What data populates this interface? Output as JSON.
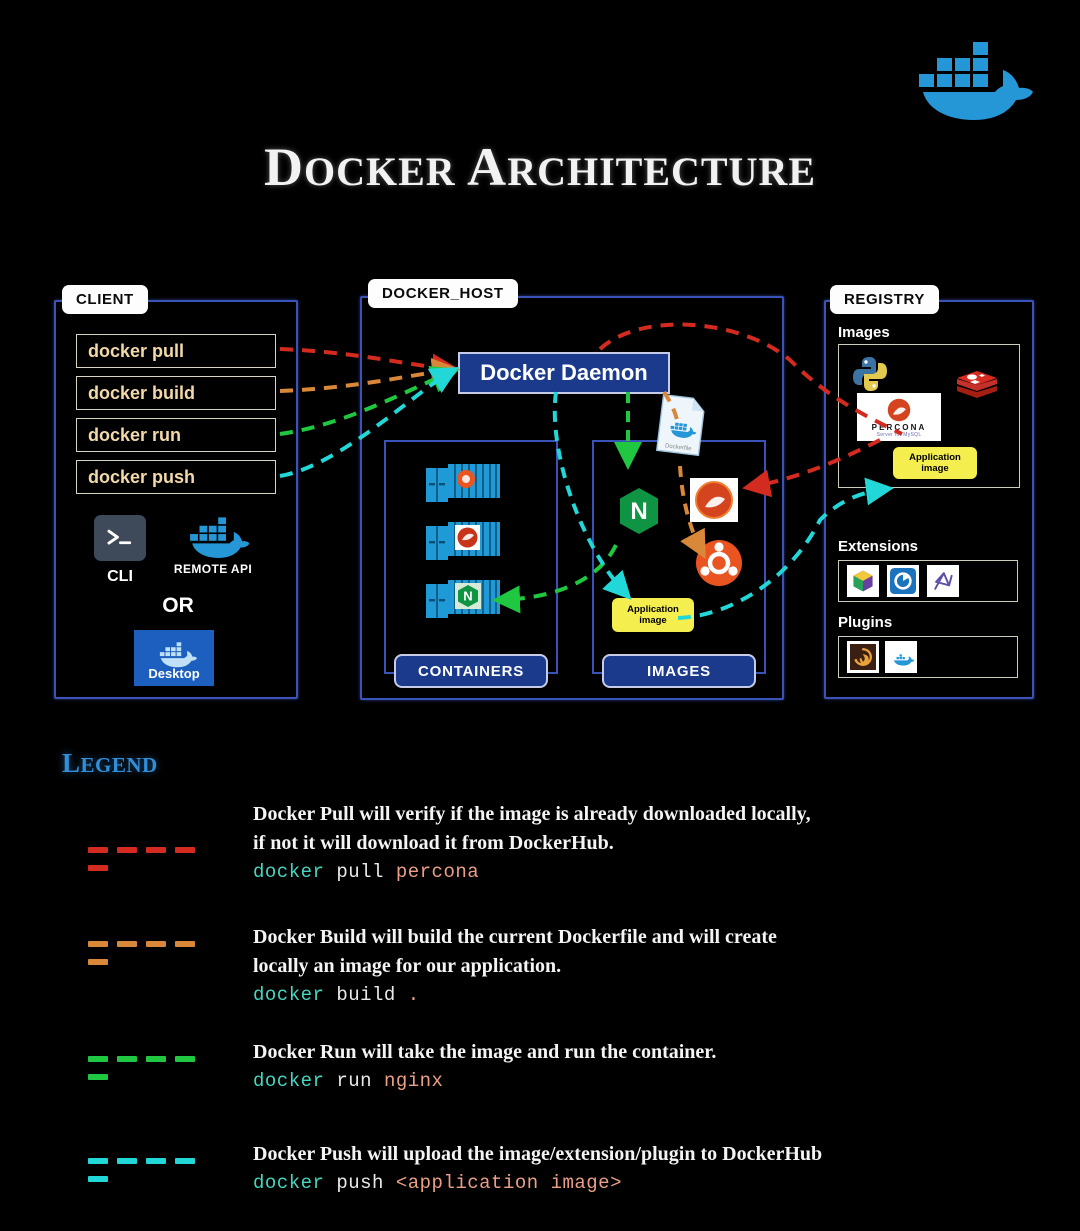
{
  "header": {
    "title_parts": [
      {
        "text": "D",
        "style": "cap"
      },
      {
        "text": "OCKER",
        "style": "sc"
      },
      {
        "text": " A",
        "style": "cap"
      },
      {
        "text": "RCHITECTURE",
        "style": "sc"
      }
    ],
    "title": "DOCKER ARCHITECTURE",
    "logo_icon": "docker-whale-icon",
    "accent_color": "#2596d6"
  },
  "client": {
    "tab_label": "CLIENT",
    "commands": [
      {
        "label": "docker pull",
        "line_color": "#d42b20"
      },
      {
        "label": "docker build",
        "line_color": "#d9883a"
      },
      {
        "label": "docker run",
        "line_color": "#1fc840"
      },
      {
        "label": "docker push",
        "line_color": "#22d7d7"
      }
    ],
    "cli": {
      "icon": "terminal-prompt-icon",
      "glyph": ">_",
      "label": "CLI"
    },
    "remote_api": {
      "icon": "docker-whale-icon",
      "label": "REMOTE API"
    },
    "or_label": "OR",
    "desktop": {
      "icon": "docker-whale-icon",
      "label": "Desktop",
      "color": "#1d5fbf"
    }
  },
  "docker_host": {
    "tab_label": "DOCKER_HOST",
    "daemon_label": "Docker Daemon",
    "containers": {
      "section_label": "CONTAINERS",
      "items": [
        {
          "icon": "ubuntu-container-icon",
          "name": "ubuntu"
        },
        {
          "icon": "percona-container-icon",
          "name": "percona"
        },
        {
          "icon": "nginx-container-icon",
          "name": "nginx"
        }
      ]
    },
    "images": {
      "section_label": "IMAGES",
      "items": [
        {
          "icon": "nginx-icon",
          "name": "nginx"
        },
        {
          "icon": "percona-icon",
          "name": "percona"
        },
        {
          "icon": "ubuntu-icon",
          "name": "ubuntu"
        }
      ],
      "application_image_label": "Application image",
      "application_image_line1": "Application",
      "application_image_line2": "image",
      "application_image_color": "#f4ee4f"
    },
    "dockerfile": {
      "icon": "dockerfile-icon",
      "label": "Dockerfile"
    }
  },
  "registry": {
    "tab_label": "REGISTRY",
    "images_label": "Images",
    "images_items": [
      {
        "icon": "python-icon",
        "name": "python"
      },
      {
        "icon": "redis-icon",
        "name": "redis"
      },
      {
        "icon": "percona-icon",
        "name": "percona"
      }
    ],
    "percona_word": "PERCONA",
    "percona_sub": "Server for MySQL",
    "application_image_line1": "Application",
    "application_image_line2": "image",
    "extensions_label": "Extensions",
    "extensions_items": [
      {
        "icon": "cube-extension-icon",
        "name": "portainer-cube"
      },
      {
        "icon": "disk-usage-extension-icon",
        "name": "disk-usage"
      },
      {
        "icon": "curve-extension-icon",
        "name": "ddev"
      }
    ],
    "plugins_label": "Plugins",
    "plugins_items": [
      {
        "icon": "spiral-plugin-icon",
        "name": "loki"
      },
      {
        "icon": "whale-plugin-icon",
        "name": "docker-volume"
      }
    ]
  },
  "legend": {
    "title_parts": [
      {
        "text": "L",
        "style": "cap"
      },
      {
        "text": "EGEND",
        "style": "sc"
      }
    ],
    "title": "LEGEND",
    "title_color": "#2f8fd8",
    "entries": [
      {
        "color": "#d42b20",
        "desc_lines": [
          "Docker Pull will verify if the image is already downloaded locally,",
          "if not it will download it from DockerHub."
        ],
        "cmd_tool": "docker",
        "cmd_verb": "pull",
        "cmd_arg": "percona"
      },
      {
        "color": "#d9883a",
        "desc_lines": [
          "Docker Build will build the current Dockerfile and will create",
          "locally an image for our application."
        ],
        "cmd_tool": "docker",
        "cmd_verb": "build",
        "cmd_arg": "."
      },
      {
        "color": "#1fc840",
        "desc_lines": [
          "Docker Run will take the image and run the container."
        ],
        "cmd_tool": "docker",
        "cmd_verb": "run",
        "cmd_arg": "nginx"
      },
      {
        "color": "#22d7d7",
        "desc_lines": [
          "Docker Push will upload the image/extension/plugin to DockerHub"
        ],
        "cmd_tool": "docker",
        "cmd_verb": "push",
        "cmd_arg": "<application image>"
      }
    ]
  }
}
